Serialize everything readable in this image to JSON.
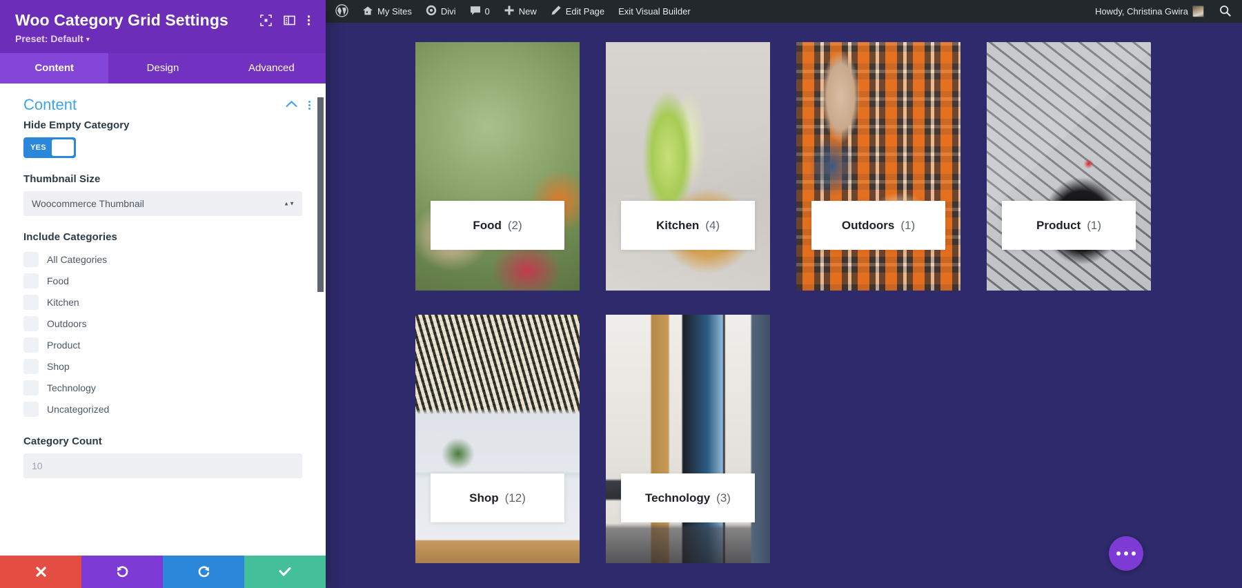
{
  "settings_panel": {
    "title": "Woo Category Grid Settings",
    "preset_label": "Preset: Default",
    "header_icons": [
      "expand-icon",
      "panel-layout-icon",
      "more-options-icon"
    ],
    "tabs": [
      {
        "label": "Content",
        "active": true
      },
      {
        "label": "Design",
        "active": false
      },
      {
        "label": "Advanced",
        "active": false
      }
    ],
    "section": {
      "title": "Content",
      "collapse_icon": "chevron-up-icon",
      "more_icon": "more-options-icon"
    },
    "fields": {
      "hide_empty_category": {
        "label": "Hide Empty Category",
        "toggle_value": "YES"
      },
      "thumbnail_size": {
        "label": "Thumbnail Size",
        "selected": "Woocommerce Thumbnail"
      },
      "include_categories": {
        "label": "Include Categories",
        "options": [
          {
            "label": "All Categories",
            "checked": false
          },
          {
            "label": "Food",
            "checked": false
          },
          {
            "label": "Kitchen",
            "checked": false
          },
          {
            "label": "Outdoors",
            "checked": false
          },
          {
            "label": "Product",
            "checked": false
          },
          {
            "label": "Shop",
            "checked": false
          },
          {
            "label": "Technology",
            "checked": false
          },
          {
            "label": "Uncategorized",
            "checked": false
          }
        ]
      },
      "category_count": {
        "label": "Category Count",
        "value": "10",
        "placeholder": "10"
      }
    },
    "action_bar": [
      {
        "name": "cancel",
        "icon": "close-icon",
        "color": "#e34d42"
      },
      {
        "name": "undo",
        "icon": "undo-icon",
        "color": "#7e3ad4"
      },
      {
        "name": "redo",
        "icon": "redo-icon",
        "color": "#2b87da"
      },
      {
        "name": "save",
        "icon": "check-icon",
        "color": "#43bf9a"
      }
    ]
  },
  "admin_bar": {
    "wp_logo": "wordpress-logo-icon",
    "items": [
      {
        "label": "My Sites",
        "icon": "sites-icon"
      },
      {
        "label": "Divi",
        "icon": "divi-icon"
      },
      {
        "label": "0",
        "icon": "comment-icon"
      },
      {
        "label": "New",
        "icon": "plus-icon"
      },
      {
        "label": "Edit Page",
        "icon": "pencil-icon"
      },
      {
        "label": "Exit Visual Builder",
        "icon": ""
      }
    ],
    "howdy": "Howdy, Christina Gwira",
    "avatar": "user-avatar",
    "search_icon": "search-icon"
  },
  "canvas": {
    "background_color": "#2e2a6b",
    "fab": {
      "name": "page-settings-fab",
      "icon": "ellipsis-icon",
      "color": "#7e3ad4"
    },
    "categories": [
      {
        "name": "Food",
        "count": "(2)",
        "image": "artichokes-and-fruit"
      },
      {
        "name": "Kitchen",
        "count": "(4)",
        "image": "lettuce-and-bagel"
      },
      {
        "name": "Outdoors",
        "count": "(1)",
        "image": "picnic-blanket"
      },
      {
        "name": "Product",
        "count": "(1)",
        "image": "laptop-and-headphones"
      },
      {
        "name": "Shop",
        "count": "(12)",
        "image": "dining-room-table"
      },
      {
        "name": "Technology",
        "count": "(3)",
        "image": "tv-wall-unit"
      }
    ]
  },
  "colors": {
    "panel_header": "#6c2eb9",
    "tab_bar": "#7231c0",
    "tab_active": "#8346d8",
    "section_title": "#3ba4f2",
    "toggle_on": "#2b87da",
    "canvas_bg": "#2e2a6b",
    "adminbar_bg": "#23282d"
  }
}
